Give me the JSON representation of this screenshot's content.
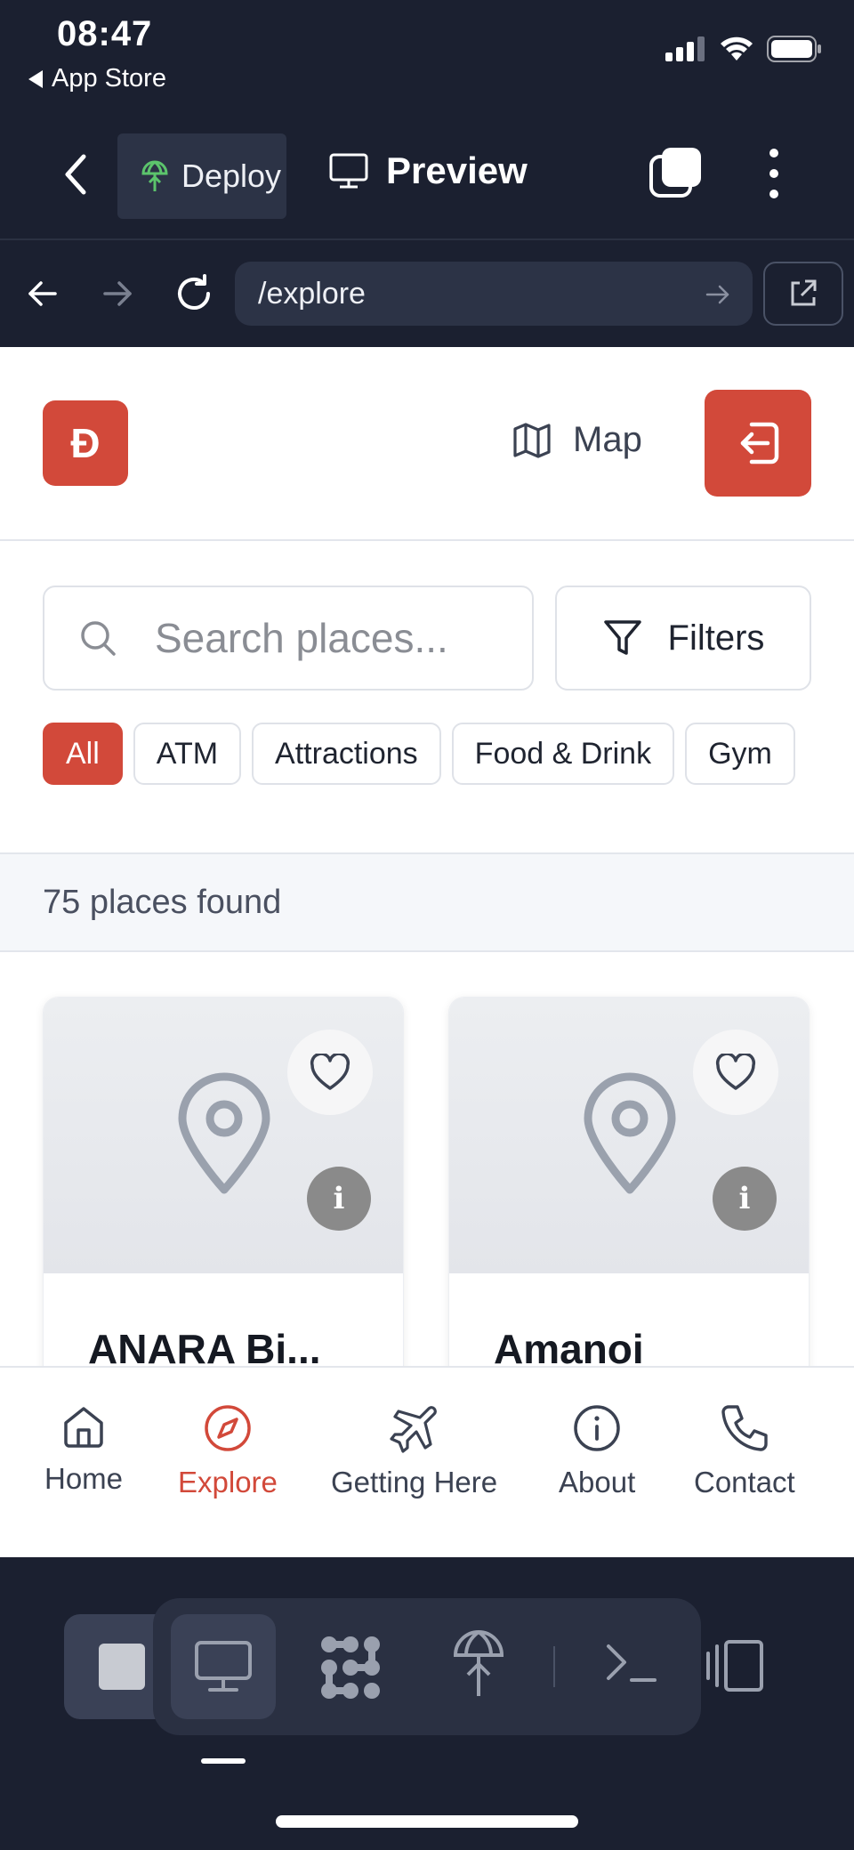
{
  "status_bar": {
    "time": "08:47",
    "back_app": "App Store"
  },
  "toolbar": {
    "deploy_label": "Deploy",
    "preview_label": "Preview"
  },
  "url_bar": {
    "path": "/explore"
  },
  "site": {
    "logo_text": "Đ",
    "map_label": "Map",
    "search_placeholder": "Search places...",
    "filters_label": "Filters",
    "chips": [
      "All",
      "ATM",
      "Attractions",
      "Food & Drink",
      "Gym"
    ],
    "active_chip": "All",
    "results_count": "75 places found",
    "cards": [
      {
        "name": "ANARA Bi..."
      },
      {
        "name": "Amanoi"
      }
    ],
    "tabs": [
      {
        "label": "Home",
        "icon": "home-icon"
      },
      {
        "label": "Explore",
        "icon": "compass-icon"
      },
      {
        "label": "Getting Here",
        "icon": "plane-icon"
      },
      {
        "label": "About",
        "icon": "info-icon"
      },
      {
        "label": "Contact",
        "icon": "phone-icon"
      }
    ],
    "active_tab": "Explore"
  },
  "colors": {
    "accent": "#d2493a",
    "chrome_bg": "#1b2030",
    "chrome_field": "#2c3346"
  }
}
